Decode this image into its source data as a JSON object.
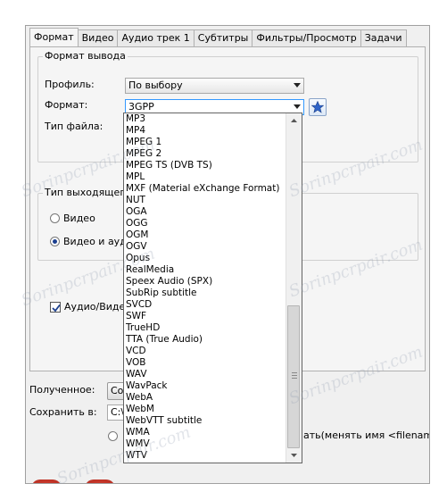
{
  "tabs": [
    "Формат",
    "Видео",
    "Аудио трек 1",
    "Субтитры",
    "Фильтры/Просмотр",
    "Задачи"
  ],
  "format_group": {
    "title": "Формат вывода",
    "profile_label": "Профиль:",
    "profile_value": "По выбору",
    "format_label": "Формат:",
    "format_value": "3GPP",
    "file_type_label": "Тип файла:"
  },
  "output_type_group": {
    "title": "Тип выходящего",
    "option_video": "Видео",
    "option_video_audio": "Видео и аудио"
  },
  "audio_video_checkbox": "Аудио/Видео",
  "received_label": "Полученное:",
  "received_button": "Со",
  "save_label": "Сохранить в:",
  "save_path": "C:\\",
  "rename_text": "ать(менять имя <filename",
  "dropdown_items": [
    "MP3",
    "MP4",
    "MPEG 1",
    "MPEG 2",
    "MPEG TS (DVB TS)",
    "MPL",
    "MXF (Material eXchange Format)",
    "NUT",
    "OGA",
    "OGG",
    "OGM",
    "OGV",
    "Opus",
    "RealMedia",
    "Speex Audio (SPX)",
    "SubRip subtitle",
    "SVCD",
    "SWF",
    "TrueHD",
    "TTA (True Audio)",
    "VCD",
    "VOB",
    "WAV",
    "WavPack",
    "WebA",
    "WebM",
    "WebVTT subtitle",
    "WMA",
    "WMV",
    "WTV"
  ],
  "watermark": "Sorinpcrpair.com",
  "icons": {
    "favorite": "star-icon",
    "scroll_up": "arrow-up-icon",
    "scroll_down": "arrow-down-icon"
  },
  "colors": {
    "focus": "#3399ff",
    "star": "#2f64c8"
  }
}
